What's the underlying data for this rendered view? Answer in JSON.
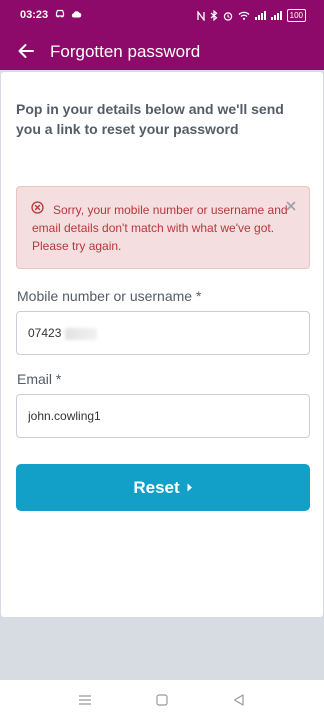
{
  "status_bar": {
    "time": "03:23",
    "battery": "100"
  },
  "header": {
    "title": "Forgotten password",
    "back_icon": "arrow-left-icon"
  },
  "intro_text": "Pop in your details below and we'll send you a link to reset your password",
  "alert": {
    "message": "Sorry, your mobile number or username and email details don't match with what we've got. Please try again.",
    "icon": "error-circle-icon",
    "close_icon": "close-icon"
  },
  "form": {
    "mobile_label": "Mobile number or username *",
    "mobile_value": "07423",
    "email_label": "Email *",
    "email_value": "john.cowling1"
  },
  "reset_button": {
    "label": "Reset",
    "icon": "chevron-right-icon"
  },
  "colors": {
    "brand": "#8e0a6a",
    "primary_button": "#12a0c9",
    "error_text": "#b5383d",
    "error_bg": "#f5dedf"
  }
}
